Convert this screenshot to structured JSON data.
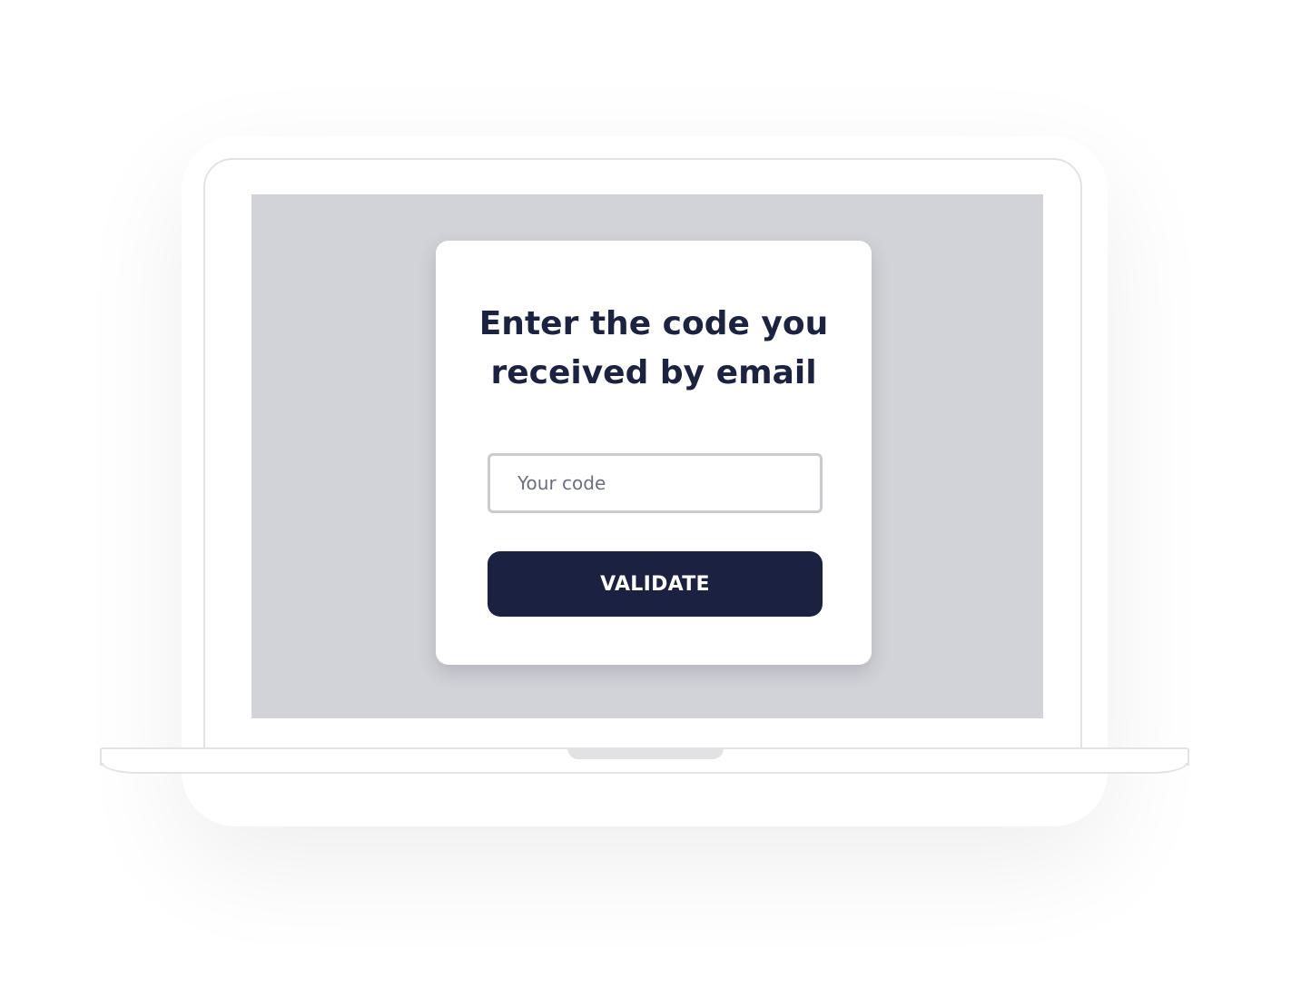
{
  "dialog": {
    "title_line_1": "Enter the code you",
    "title_line_2": "received by email",
    "code_input": {
      "placeholder": "Your code",
      "value": ""
    },
    "validate_label": "VALIDATE"
  },
  "colors": {
    "primary": "#1b2140",
    "title_text": "#1b2340",
    "screen_background": "#d2d3d8",
    "input_border": "#c9cbd0",
    "device_outline": "#e3e3e5"
  }
}
